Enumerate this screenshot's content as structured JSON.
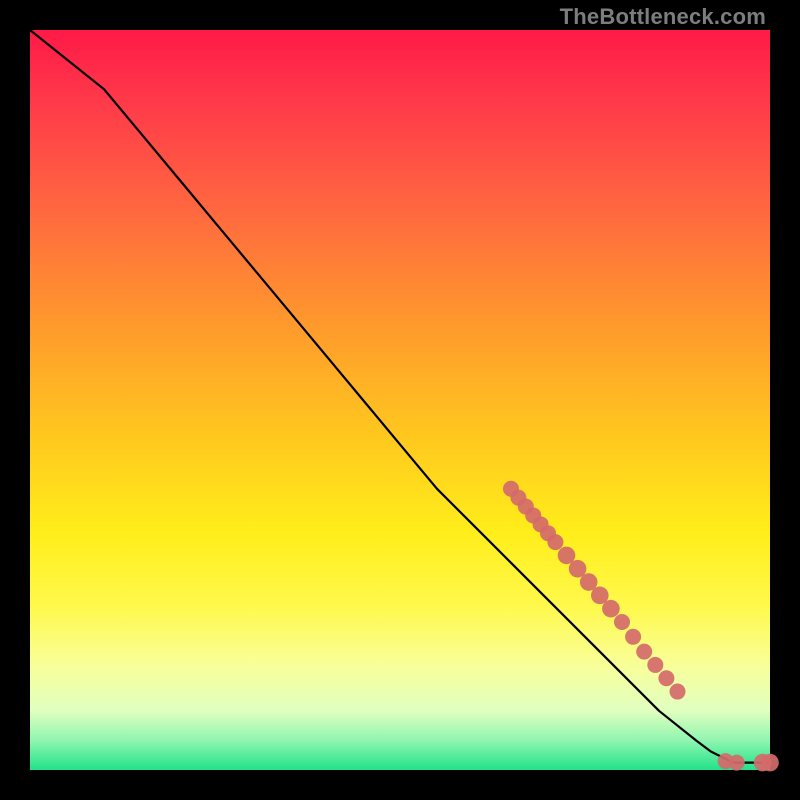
{
  "watermark": "TheBottleneck.com",
  "chart_data": {
    "type": "line",
    "title": "",
    "xlabel": "",
    "ylabel": "",
    "xlim": [
      0,
      100
    ],
    "ylim": [
      0,
      100
    ],
    "grid": false,
    "legend": false,
    "series": [
      {
        "name": "curve",
        "stroke": "#000000",
        "x": [
          0,
          5,
          10,
          15,
          20,
          25,
          30,
          35,
          40,
          45,
          50,
          55,
          60,
          65,
          70,
          75,
          80,
          85,
          90,
          92,
          95,
          98,
          100
        ],
        "y": [
          100,
          96,
          92,
          86,
          80,
          74,
          68,
          62,
          56,
          50,
          44,
          38,
          33,
          28,
          23,
          18,
          13,
          8,
          4,
          2.5,
          1,
          1,
          1
        ]
      }
    ],
    "markers": [
      {
        "x": 65,
        "y": 38,
        "r": 2.0
      },
      {
        "x": 66,
        "y": 36.8,
        "r": 2.0
      },
      {
        "x": 67,
        "y": 35.6,
        "r": 2.0
      },
      {
        "x": 68,
        "y": 34.4,
        "r": 2.0
      },
      {
        "x": 69,
        "y": 33.2,
        "r": 2.0
      },
      {
        "x": 70,
        "y": 32.0,
        "r": 2.0
      },
      {
        "x": 71,
        "y": 30.8,
        "r": 2.0
      },
      {
        "x": 72.5,
        "y": 29.0,
        "r": 2.2
      },
      {
        "x": 74,
        "y": 27.2,
        "r": 2.2
      },
      {
        "x": 75.5,
        "y": 25.4,
        "r": 2.2
      },
      {
        "x": 77,
        "y": 23.6,
        "r": 2.2
      },
      {
        "x": 78.5,
        "y": 21.8,
        "r": 2.2
      },
      {
        "x": 80,
        "y": 20.0,
        "r": 2.0
      },
      {
        "x": 81.5,
        "y": 18.0,
        "r": 2.0
      },
      {
        "x": 83,
        "y": 16.0,
        "r": 2.0
      },
      {
        "x": 84.5,
        "y": 14.2,
        "r": 2.0
      },
      {
        "x": 86,
        "y": 12.4,
        "r": 2.0
      },
      {
        "x": 87.5,
        "y": 10.6,
        "r": 2.0
      },
      {
        "x": 94,
        "y": 1.2,
        "r": 2.0
      },
      {
        "x": 95.5,
        "y": 1.0,
        "r": 2.0
      },
      {
        "x": 99,
        "y": 1.0,
        "r": 2.2
      },
      {
        "x": 100,
        "y": 1.0,
        "r": 2.2
      }
    ],
    "marker_color": "#d46a6a"
  }
}
